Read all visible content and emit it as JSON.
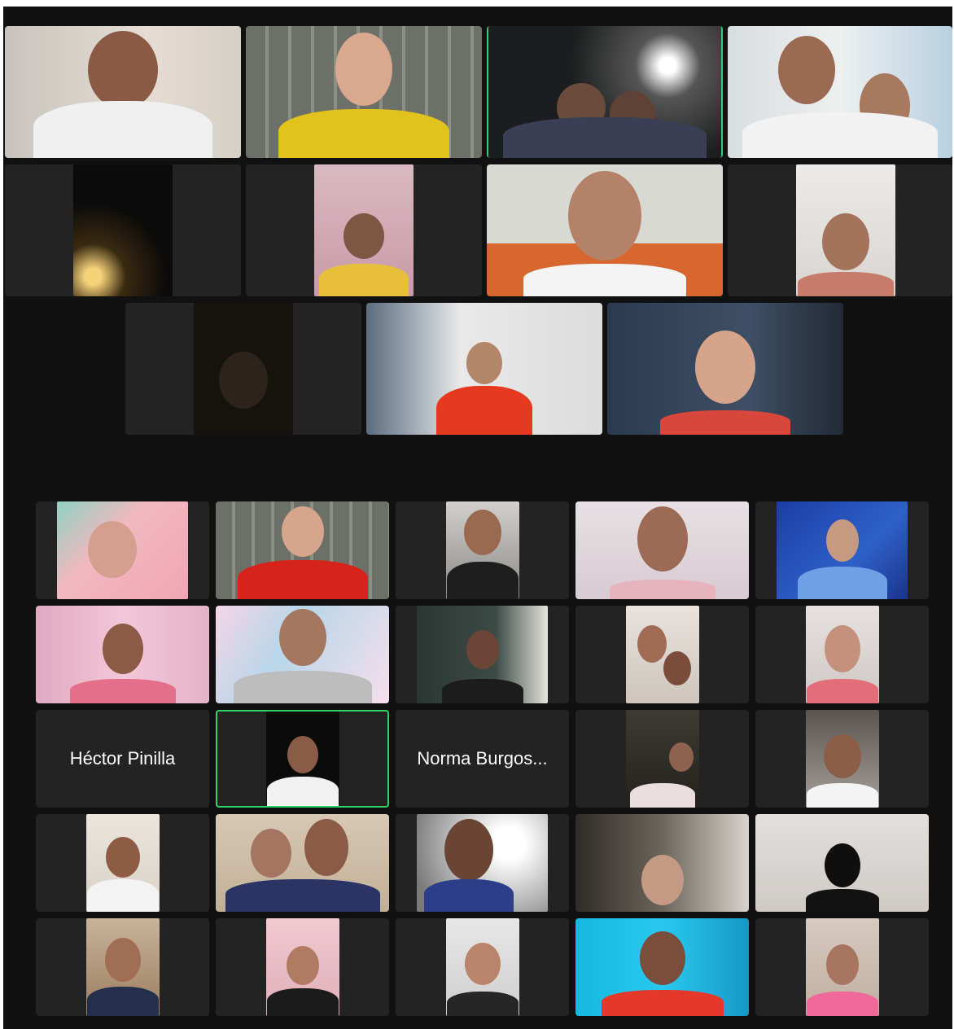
{
  "app": {
    "name": "Video meeting gallery view"
  },
  "participants_with_names_shown": [
    {
      "name": "Héctor Pinilla"
    },
    {
      "name": "Norma Burgos..."
    }
  ],
  "colors": {
    "background": "#111111",
    "tile": "#232323",
    "active_speaker": "#2fd366"
  }
}
